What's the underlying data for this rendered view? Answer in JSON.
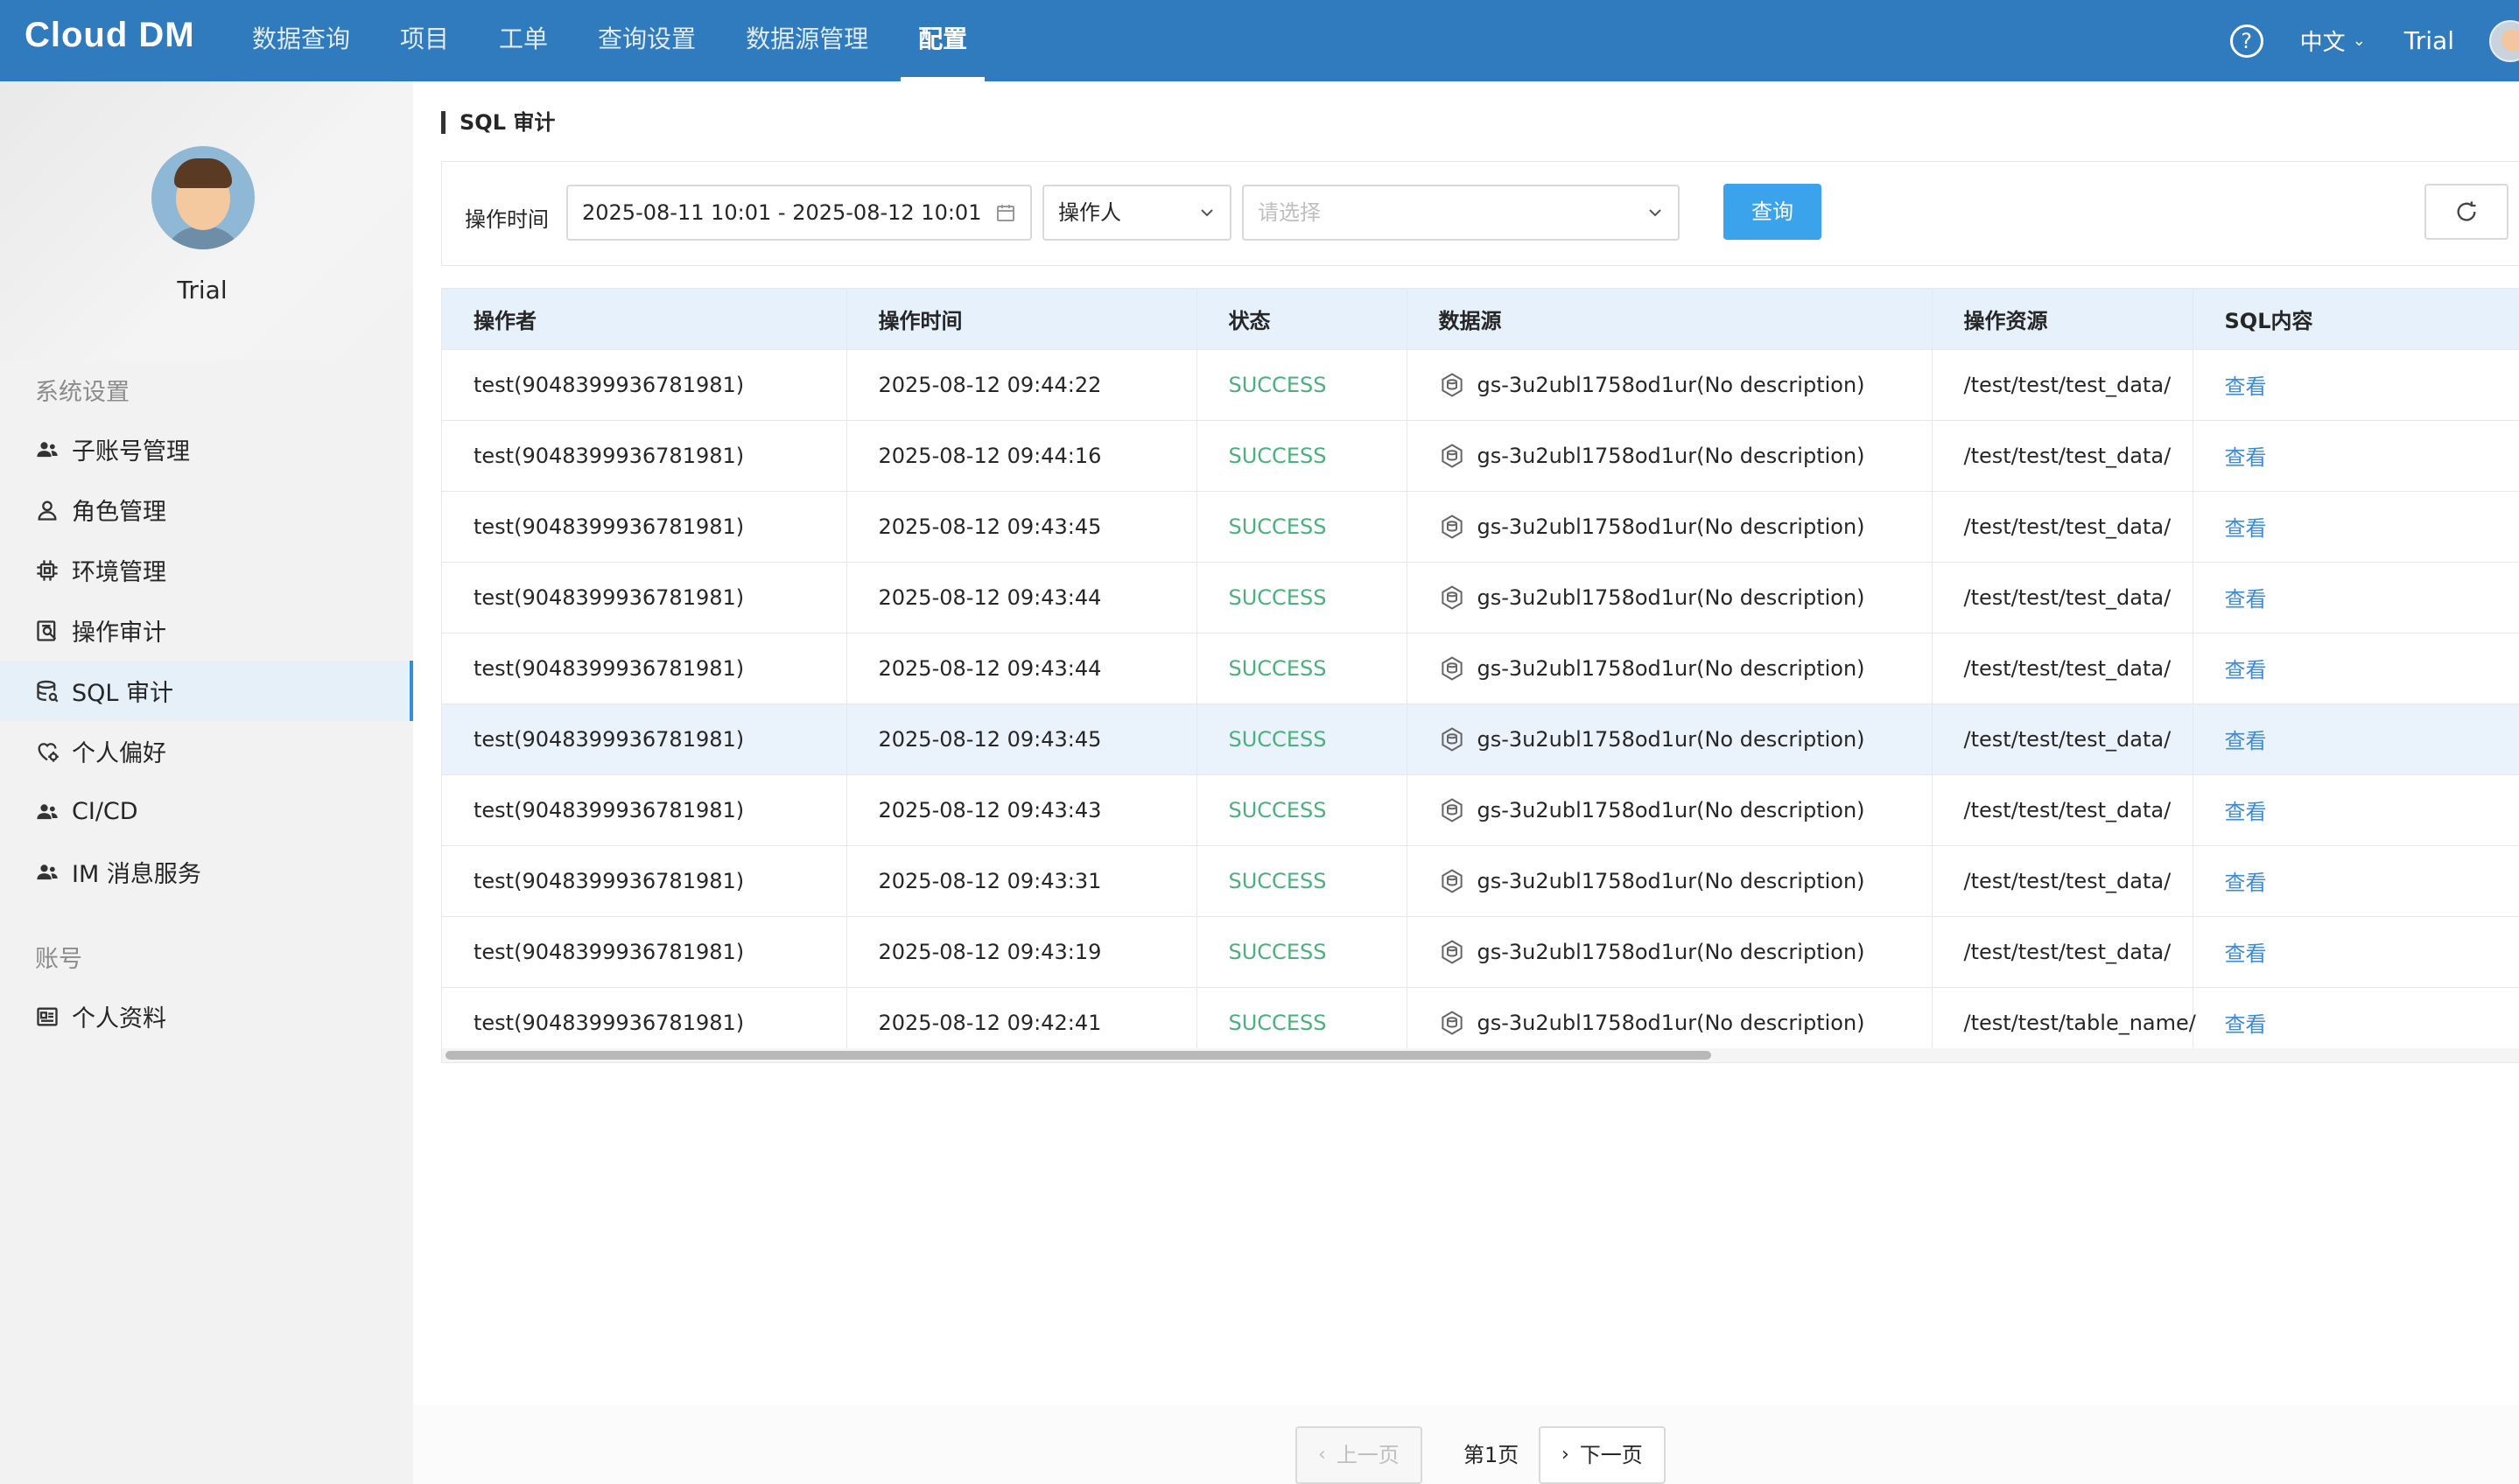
{
  "topbar": {
    "logo": "Cloud DM",
    "nav": [
      "数据查询",
      "项目",
      "工单",
      "查询设置",
      "数据源管理",
      "配置"
    ],
    "active_nav": "配置",
    "lang": "中文",
    "user": "Trial"
  },
  "sidebar": {
    "profile_name": "Trial",
    "section_system": "系统设置",
    "items": [
      {
        "label": "子账号管理",
        "icon": "users-icon"
      },
      {
        "label": "角色管理",
        "icon": "user-role-icon"
      },
      {
        "label": "环境管理",
        "icon": "chip-icon"
      },
      {
        "label": "操作审计",
        "icon": "audit-icon"
      },
      {
        "label": "SQL 审计",
        "icon": "database-icon"
      },
      {
        "label": "个人偏好",
        "icon": "preference-icon"
      },
      {
        "label": "CI/CD",
        "icon": "users-icon"
      },
      {
        "label": "IM 消息服务",
        "icon": "users-icon"
      }
    ],
    "active_item": "SQL 审计",
    "section_account": "账号",
    "account_items": [
      {
        "label": "个人资料",
        "icon": "profile-card-icon"
      }
    ]
  },
  "main": {
    "title": "SQL 审计",
    "filter": {
      "time_label": "操作时间",
      "date_range": "2025-08-11 10:01 - 2025-08-12 10:01",
      "field_select": "操作人",
      "value_placeholder": "请选择",
      "query_button": "查询"
    },
    "table": {
      "columns": [
        "操作者",
        "操作时间",
        "状态",
        "数据源",
        "操作资源",
        "SQL内容"
      ],
      "rows": [
        {
          "operator": "test(9048399936781981)",
          "time": "2025-08-12 09:44:22",
          "status": "SUCCESS",
          "datasource": "gs-3u2ubl1758od1ur(No description)",
          "resource": "/test/test/test_data/",
          "action": "查看"
        },
        {
          "operator": "test(9048399936781981)",
          "time": "2025-08-12 09:44:16",
          "status": "SUCCESS",
          "datasource": "gs-3u2ubl1758od1ur(No description)",
          "resource": "/test/test/test_data/",
          "action": "查看"
        },
        {
          "operator": "test(9048399936781981)",
          "time": "2025-08-12 09:43:45",
          "status": "SUCCESS",
          "datasource": "gs-3u2ubl1758od1ur(No description)",
          "resource": "/test/test/test_data/",
          "action": "查看"
        },
        {
          "operator": "test(9048399936781981)",
          "time": "2025-08-12 09:43:44",
          "status": "SUCCESS",
          "datasource": "gs-3u2ubl1758od1ur(No description)",
          "resource": "/test/test/test_data/",
          "action": "查看"
        },
        {
          "operator": "test(9048399936781981)",
          "time": "2025-08-12 09:43:44",
          "status": "SUCCESS",
          "datasource": "gs-3u2ubl1758od1ur(No description)",
          "resource": "/test/test/test_data/",
          "action": "查看"
        },
        {
          "operator": "test(9048399936781981)",
          "time": "2025-08-12 09:43:45",
          "status": "SUCCESS",
          "datasource": "gs-3u2ubl1758od1ur(No description)",
          "resource": "/test/test/test_data/",
          "action": "查看",
          "highlight": true
        },
        {
          "operator": "test(9048399936781981)",
          "time": "2025-08-12 09:43:43",
          "status": "SUCCESS",
          "datasource": "gs-3u2ubl1758od1ur(No description)",
          "resource": "/test/test/test_data/",
          "action": "查看"
        },
        {
          "operator": "test(9048399936781981)",
          "time": "2025-08-12 09:43:31",
          "status": "SUCCESS",
          "datasource": "gs-3u2ubl1758od1ur(No description)",
          "resource": "/test/test/test_data/",
          "action": "查看"
        },
        {
          "operator": "test(9048399936781981)",
          "time": "2025-08-12 09:43:19",
          "status": "SUCCESS",
          "datasource": "gs-3u2ubl1758od1ur(No description)",
          "resource": "/test/test/test_data/",
          "action": "查看"
        },
        {
          "operator": "test(9048399936781981)",
          "time": "2025-08-12 09:42:41",
          "status": "SUCCESS",
          "datasource": "gs-3u2ubl1758od1ur(No description)",
          "resource": "/test/test/table_name/",
          "action": "查看"
        }
      ]
    },
    "pager": {
      "prev": "上一页",
      "page": "第1页",
      "next": "下一页"
    }
  },
  "colors": {
    "topbar": "#2f7bbd",
    "accent": "#3ba3ec",
    "success": "#4caf7d",
    "link": "#3b8bd8",
    "active_row": "#eaf3fb"
  }
}
